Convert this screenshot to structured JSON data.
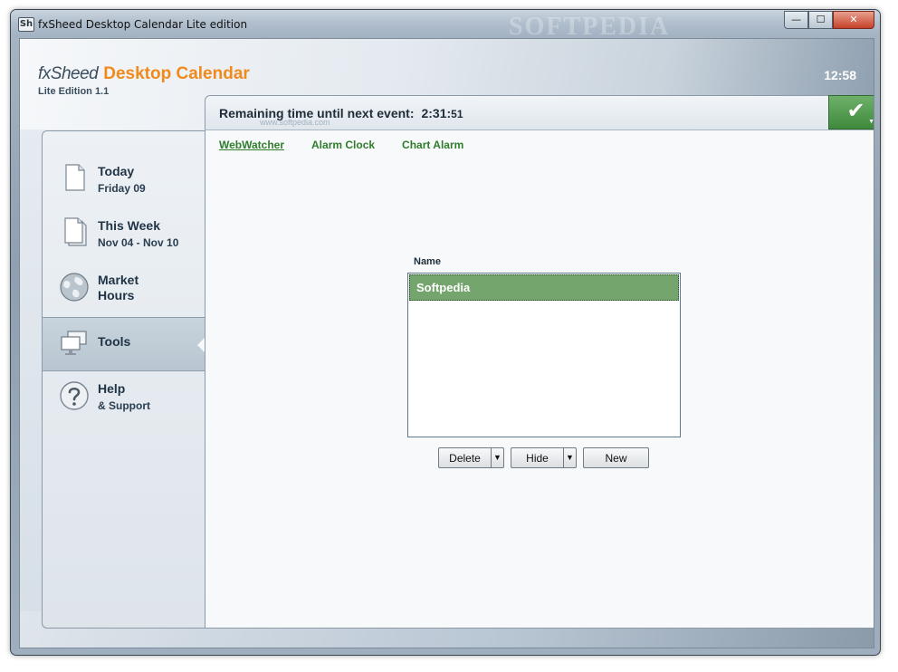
{
  "window": {
    "title": "fxSheed Desktop Calendar Lite edition",
    "icon_text": "Sh",
    "watermark": "SOFTPEDIA",
    "controls": {
      "minimize": "—",
      "maximize": "☐",
      "close": "✕"
    }
  },
  "header": {
    "brand": "fxSheed",
    "product": "Desktop Calendar",
    "edition": "Lite Edition 1.1",
    "clock": "12:58"
  },
  "remaining": {
    "label": "Remaining time until next event:",
    "value": "2:31:",
    "seconds": "51",
    "watermark": "www.softpedia.com"
  },
  "confirm": {
    "check": "✔",
    "caret": "▼"
  },
  "sidebar": {
    "items": [
      {
        "title": "Today",
        "subtitle": "Friday 09",
        "icon": "document-icon"
      },
      {
        "title": "This Week",
        "subtitle": "Nov 04 - Nov 10",
        "icon": "document-stack-icon"
      },
      {
        "title": "Market",
        "subtitle": "Hours",
        "icon": "globe-icon"
      },
      {
        "title": "Tools",
        "subtitle": "",
        "icon": "computers-icon"
      },
      {
        "title": "Help",
        "subtitle": "& Support",
        "icon": "question-icon"
      }
    ],
    "active_index": 3
  },
  "tabs": [
    {
      "label": "WebWatcher",
      "active": true
    },
    {
      "label": "Alarm Clock",
      "active": false
    },
    {
      "label": "Chart Alarm",
      "active": false
    }
  ],
  "list": {
    "header": "Name",
    "items": [
      "Softpedia"
    ]
  },
  "buttons": {
    "delete": "Delete",
    "hide": "Hide",
    "new": "New",
    "split_arrow": "▼"
  },
  "colors": {
    "accent_orange": "#f08a1c",
    "accent_green": "#3f8a3d",
    "selection_green": "#74a56c",
    "link_green": "#2f7d2c",
    "text_dark": "#1f3345"
  }
}
